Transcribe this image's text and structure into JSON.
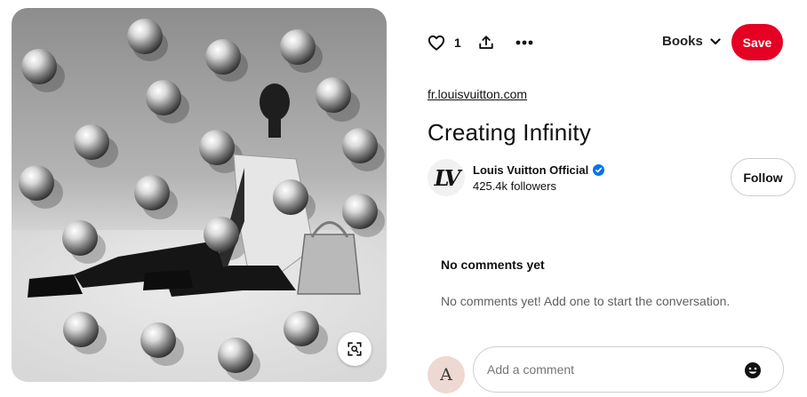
{
  "pin": {
    "image_alt": "Model seated among floating chrome spheres",
    "source_link": "fr.louisvuitton.com",
    "title": "Creating Infinity"
  },
  "actions": {
    "reaction_count": "1",
    "board_name": "Books",
    "save_label": "Save"
  },
  "creator": {
    "monogram": "LV",
    "name": "Louis Vuitton Official",
    "followers": "425.4k followers",
    "follow_label": "Follow"
  },
  "comments": {
    "heading": "No comments yet",
    "empty_message": "No comments yet! Add one to start the conversation.",
    "placeholder": "Add a comment",
    "user_initial": "A"
  },
  "colors": {
    "save_red": "#e60023",
    "verified_blue": "#0074e8"
  },
  "icons": [
    "heart-icon",
    "share-icon",
    "more-icon",
    "chevron-down-icon",
    "visual-search-icon",
    "verified-icon",
    "emoji-icon"
  ]
}
